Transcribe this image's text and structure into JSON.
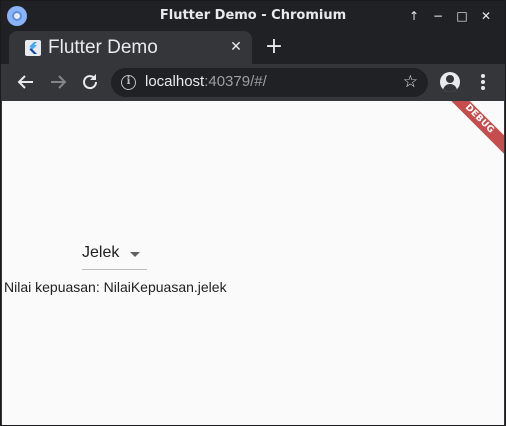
{
  "window": {
    "title": "Flutter Demo - Chromium",
    "controls": [
      "↑",
      "−",
      "□",
      "✕"
    ]
  },
  "tab": {
    "title": "Flutter Demo",
    "close_label": "✕",
    "new_tab_label": "+"
  },
  "omnibox": {
    "host": "localhost",
    "rest": ":40379/#/"
  },
  "page": {
    "debug_banner": "DEBUG",
    "dropdown_value": "Jelek",
    "status_text": "Nilai kepuasan: NilaiKepuasan.jelek"
  },
  "colors": {
    "chrome_dark": "#202124",
    "chrome_toolbar": "#35363a",
    "page_background": "#fafafa",
    "debug_banner": "#b71c1c"
  },
  "icons": {
    "browser": "chrome-logo-icon",
    "favicon": "flutter-icon",
    "back": "arrow-back-icon",
    "forward": "arrow-forward-icon",
    "reload": "reload-icon",
    "site_info": "info-icon",
    "bookmark": "star-icon",
    "profile": "account-icon",
    "menu": "more-vert-icon",
    "dropdown": "arrow-drop-down-icon"
  }
}
